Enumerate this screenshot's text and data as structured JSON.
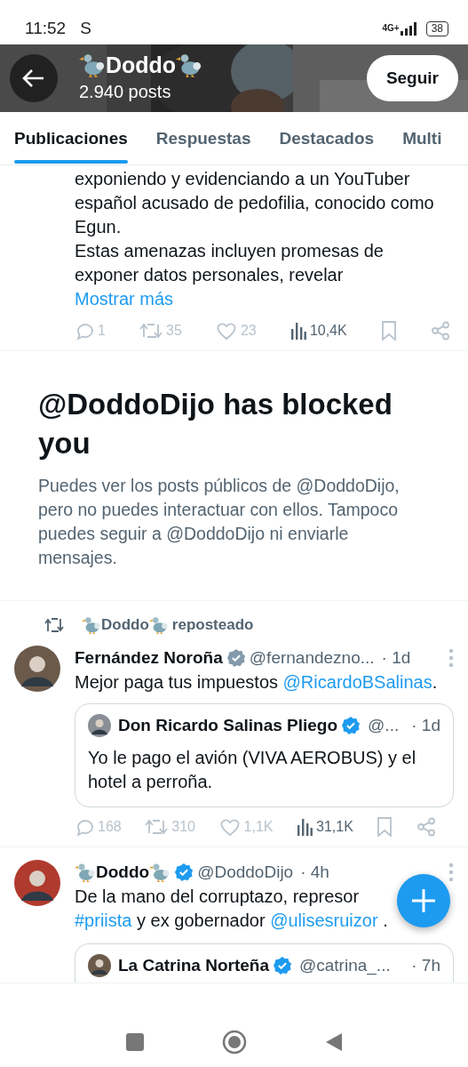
{
  "status_bar": {
    "time": "11:52",
    "carrier": "S",
    "network": "4G+",
    "battery": "38"
  },
  "header": {
    "name": "Doddo",
    "name_dodo": true,
    "posts": "2.940 posts",
    "follow_button": "Seguir"
  },
  "tabs": [
    {
      "label": "Publicaciones",
      "selected": true
    },
    {
      "label": "Respuestas",
      "selected": false
    },
    {
      "label": "Destacados",
      "selected": false
    },
    {
      "label": "Multi",
      "selected": false
    }
  ],
  "feed": [
    {
      "kind": "partial",
      "text": "exponiendo y evidenciando a un YouTuber español acusado de pedofilia, conocido como Egun.\nEstas amenazas incluyen promesas de exponer datos personales, revelar",
      "show_more": "Mostrar más",
      "actions": {
        "replies": "1",
        "reposts": "35",
        "likes": "23",
        "views": "10,4K"
      }
    },
    {
      "kind": "blocked",
      "title": "@DoddoDijo has blocked you",
      "body": "Puedes ver los posts públicos de @DoddoDijo, pero no puedes interactuar con ellos. Tampoco puedes seguir a @DoddoDijo ni enviarle mensajes."
    },
    {
      "kind": "post",
      "repost_by": "Doddo",
      "repost_label": "reposteado",
      "name": "Fernández Noroña",
      "name_dodo": false,
      "badge": {
        "color": "#829aab"
      },
      "handle": "@fernandezno...",
      "time": "· 1d",
      "segments": [
        {
          "kind": "text",
          "text": "Mejor paga tus impuestos "
        },
        {
          "kind": "mention",
          "text": "@RicardoBSalinas"
        },
        {
          "kind": "text",
          "text": "."
        }
      ],
      "quote": {
        "name": "Don Ricardo Salinas Pliego",
        "badge": {
          "color": "#1d9bf0"
        },
        "handle": "@...",
        "time": "· 1d",
        "text": "Yo le pago el avión (VIVA AEROBUS) y el hotel a perroña."
      },
      "actions": {
        "replies": "168",
        "reposts": "310",
        "likes": "1,1K",
        "views": "31,1K"
      }
    },
    {
      "kind": "post",
      "name": "Doddo",
      "name_dodo": true,
      "badge": {
        "color": "#1d9bf0"
      },
      "handle": "@DoddoDijo",
      "time": "· 4h",
      "segments": [
        {
          "kind": "text",
          "text": "De la mano del corruptazo, represor "
        },
        {
          "kind": "hashtag",
          "text": "#priista"
        },
        {
          "kind": "text",
          "text": " y ex gobernador "
        },
        {
          "kind": "mention",
          "text": "@ulisesruizor"
        },
        {
          "kind": "text",
          "text": " ."
        }
      ],
      "quote": {
        "name": "La Catrina Norteña",
        "badge": {
          "color": "#1d9bf0"
        },
        "handle": "@catrina_...",
        "time": "· 7h"
      }
    }
  ]
}
